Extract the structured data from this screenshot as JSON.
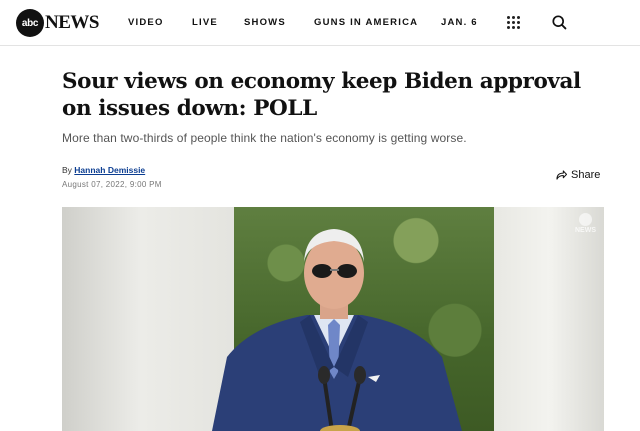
{
  "brand": {
    "logo_mark": "abc",
    "logo_word": "NEWS"
  },
  "nav": {
    "items": [
      {
        "label": "VIDEO"
      },
      {
        "label": "LIVE"
      },
      {
        "label": "SHOWS"
      },
      {
        "label": "GUNS IN AMERICA"
      },
      {
        "label": "JAN. 6"
      }
    ],
    "menu_icon": "grid-icon",
    "search_icon": "search-icon"
  },
  "article": {
    "headline": "Sour views on economy keep Biden approval on issues down: POLL",
    "subhead": "More than two-thirds of people think the nation's economy is getting worse.",
    "byline_prefix": "By",
    "author": "Hannah Demissie",
    "date": "August 07, 2022, 9:00 PM",
    "share_label": "Share",
    "share_icon": "share-arrow-icon"
  },
  "media": {
    "watermark": "NEWS"
  },
  "colors": {
    "author_link": "#0b3d91",
    "nav_text": "#111111"
  }
}
